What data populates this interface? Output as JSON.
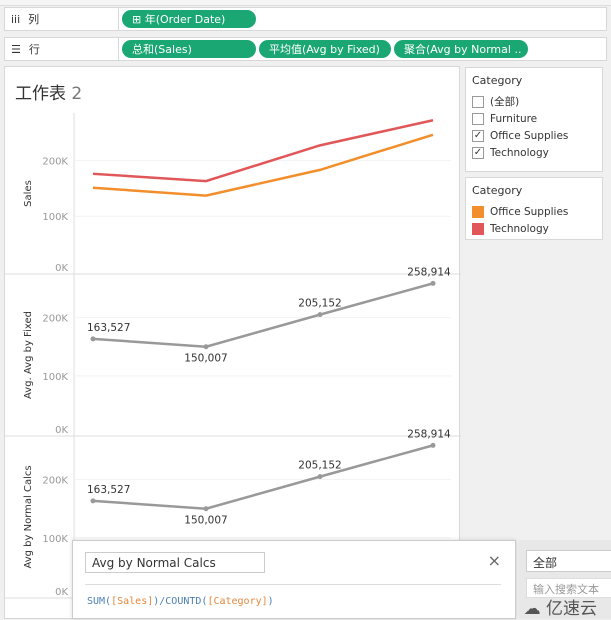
{
  "shelves": {
    "columns": {
      "label": "列",
      "icon": "columns-icon",
      "pills": [
        "⊞ 年(Order Date)"
      ]
    },
    "rows": {
      "label": "行",
      "icon": "rows-icon",
      "pills": [
        "总和(Sales)",
        "平均值(Avg by Fixed)",
        "聚合(Avg by Normal .."
      ]
    }
  },
  "sheet": {
    "title": "工作表",
    "number": "2"
  },
  "filter": {
    "title": "Category",
    "items": [
      {
        "label": "(全部)",
        "checked": false
      },
      {
        "label": "Furniture",
        "checked": false
      },
      {
        "label": "Office Supplies",
        "checked": true
      },
      {
        "label": "Technology",
        "checked": true
      }
    ]
  },
  "legend": {
    "title": "Category",
    "items": [
      {
        "label": "Office Supplies",
        "color": "#f28e2b"
      },
      {
        "label": "Technology",
        "color": "#e15759"
      }
    ]
  },
  "chart_data": [
    {
      "type": "line",
      "ylabel": "Sales",
      "yticks": [
        "0K",
        "100K",
        "200K"
      ],
      "ylim": [
        0,
        285000
      ],
      "series": [
        {
          "name": "Office Supplies",
          "color": "#f28e2b",
          "values": [
            151000,
            137000,
            183000,
            246000
          ]
        },
        {
          "name": "Technology",
          "color": "#e15759",
          "values": [
            176000,
            163000,
            227000,
            272000
          ]
        }
      ]
    },
    {
      "type": "line",
      "ylabel": "Avg. Avg by Fixed",
      "yticks": [
        "0K",
        "100K",
        "200K"
      ],
      "ylim": [
        0,
        275000
      ],
      "series": [
        {
          "color": "#999999",
          "values": [
            163527,
            150007,
            205152,
            258914
          ],
          "labels": [
            "163,527",
            "150,007",
            "205,152",
            "258,914"
          ]
        }
      ]
    },
    {
      "type": "line",
      "ylabel": "Avg by Normal Calcs",
      "yticks": [
        "0K",
        "100K",
        "200K"
      ],
      "ylim": [
        0,
        275000
      ],
      "series": [
        {
          "color": "#999999",
          "values": [
            163527,
            150007,
            205152,
            258914
          ],
          "labels": [
            "163,527",
            "150,007",
            "205,152",
            "258,914"
          ]
        }
      ]
    }
  ],
  "calc_editor": {
    "name": "Avg by Normal Calcs",
    "formula_fn1": "SUM(",
    "formula_f1": "[Sales]",
    "formula_mid": ")/COUNTD(",
    "formula_f2": "[Category]",
    "formula_end": ")",
    "close": "×"
  },
  "right_panel": {
    "select": "全部",
    "search_placeholder": "输入搜索文本"
  },
  "watermark": "亿速云"
}
